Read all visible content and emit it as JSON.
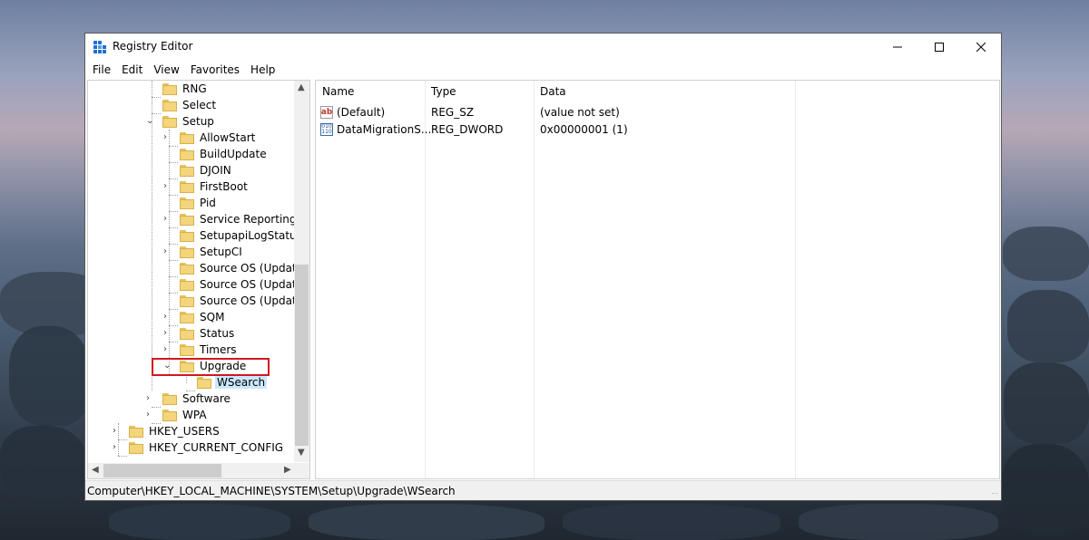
{
  "window": {
    "title": "Registry Editor",
    "minimize_icon": "minimize-icon",
    "maximize_icon": "maximize-icon",
    "close_icon": "close-icon"
  },
  "menu": [
    "File",
    "Edit",
    "View",
    "Favorites",
    "Help"
  ],
  "tree": {
    "items": [
      "RNG",
      "Select",
      "Setup",
      "AllowStart",
      "BuildUpdate",
      "DJOIN",
      "FirstBoot",
      "Pid",
      "Service Reporting AP",
      "SetupapiLogStatus",
      "SetupCI",
      "Source OS (Updated",
      "Source OS (Updated",
      "Source OS (Updated",
      "SQM",
      "Status",
      "Timers",
      "Upgrade",
      "WSearch",
      "Software",
      "WPA",
      "HKEY_USERS",
      "HKEY_CURRENT_CONFIG"
    ],
    "selected": "WSearch",
    "highlighted": "Upgrade"
  },
  "list": {
    "columns": [
      "Name",
      "Type",
      "Data"
    ],
    "rows": [
      {
        "name": "(Default)",
        "type": "REG_SZ",
        "data": "(value not set)",
        "icon": "string-value-icon"
      },
      {
        "name": "DataMigrationS...",
        "type": "REG_DWORD",
        "data": "0x00000001 (1)",
        "icon": "binary-value-icon"
      }
    ]
  },
  "status": {
    "path": "Computer\\HKEY_LOCAL_MACHINE\\SYSTEM\\Setup\\Upgrade\\WSearch"
  },
  "colors": {
    "selection": "#cce8ff",
    "highlight_box": "#d0181f",
    "folder": "#f3d57b"
  }
}
